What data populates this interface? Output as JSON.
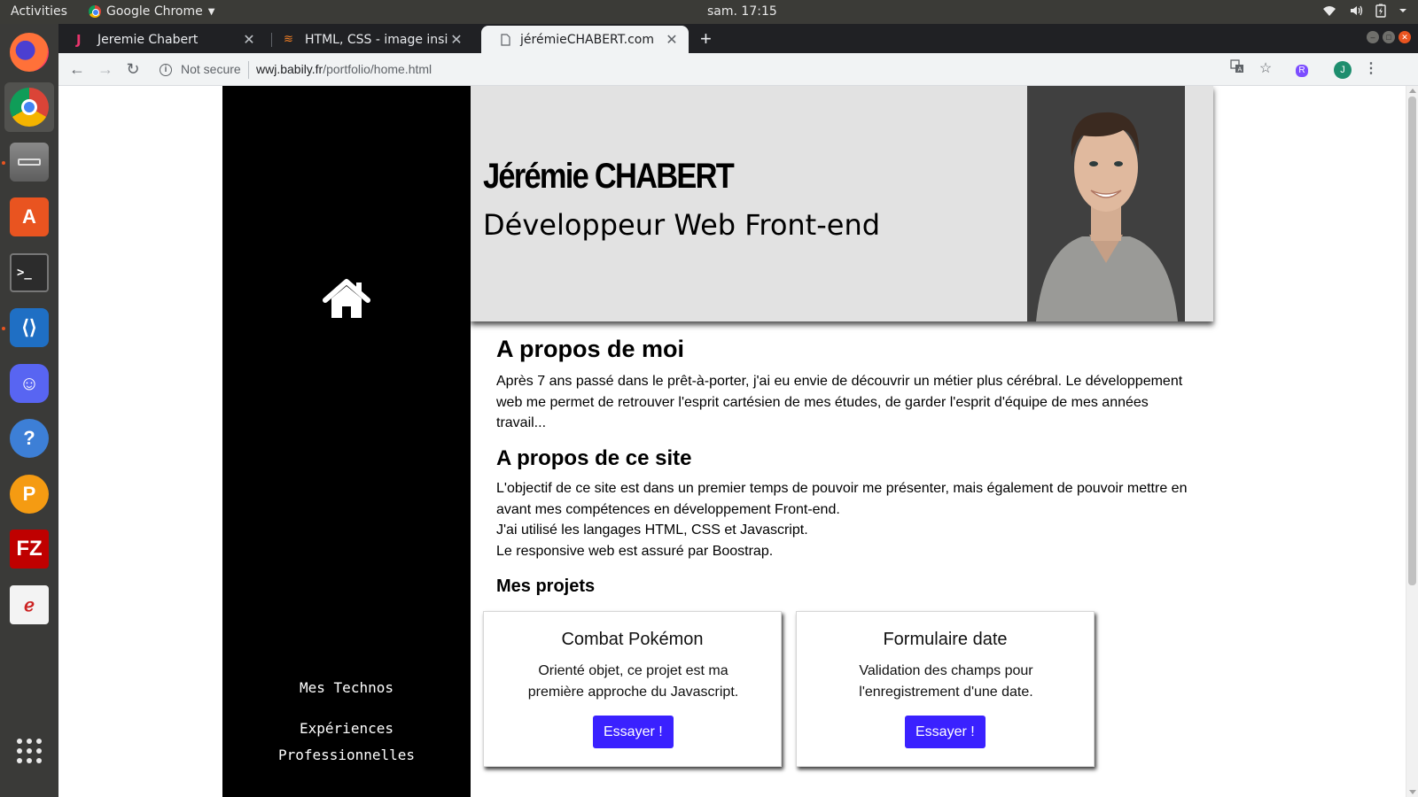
{
  "system": {
    "activities": "Activities",
    "app_name": "Google Chrome",
    "clock": "sam. 17:15"
  },
  "browser": {
    "tabs": [
      {
        "title": "Jeremie Chabert",
        "active": false
      },
      {
        "title": "HTML, CSS - image inside",
        "active": false
      },
      {
        "title": "jérémieCHABERT.com",
        "active": true
      }
    ],
    "security_label": "Not secure",
    "url_host": "wwj.babily.fr",
    "url_path": "/portfolio/home.html",
    "extension_letter": "R",
    "profile_letter": "J"
  },
  "page": {
    "header": {
      "name": "Jérémie CHABERT",
      "role": "Développeur Web Front-end"
    },
    "sidebar": {
      "links": [
        "Mes Technos",
        "Expériences",
        "Professionnelles"
      ]
    },
    "about_me": {
      "title": "A propos de moi",
      "text": "Après 7 ans passé dans le prêt-à-porter, j'ai eu envie de découvrir un métier plus cérébral. Le développement web me permet de retrouver l'esprit cartésien de mes études, de garder l'esprit d'équipe de mes années travail..."
    },
    "about_site": {
      "title": "A propos de ce site",
      "lines": [
        "L'objectif de ce site est dans un premier temps de pouvoir me présenter, mais également de pouvoir mettre en avant mes compétences en développement Front-end.",
        "J'ai utilisé les langages HTML, CSS et Javascript.",
        "Le responsive web est assuré par Boostrap."
      ]
    },
    "projects": {
      "title": "Mes projets",
      "cards": [
        {
          "title": "Combat Pokémon",
          "text": "Orienté objet, ce projet est ma première approche du Javascript.",
          "button": "Essayer !"
        },
        {
          "title": "Formulaire date",
          "text": "Validation des champs pour l'enregistrement d'une date.",
          "button": "Essayer !"
        }
      ]
    }
  },
  "colors": {
    "button": "#3a21ff",
    "sidebar": "#000000",
    "header_bg": "#e2e2e2"
  }
}
